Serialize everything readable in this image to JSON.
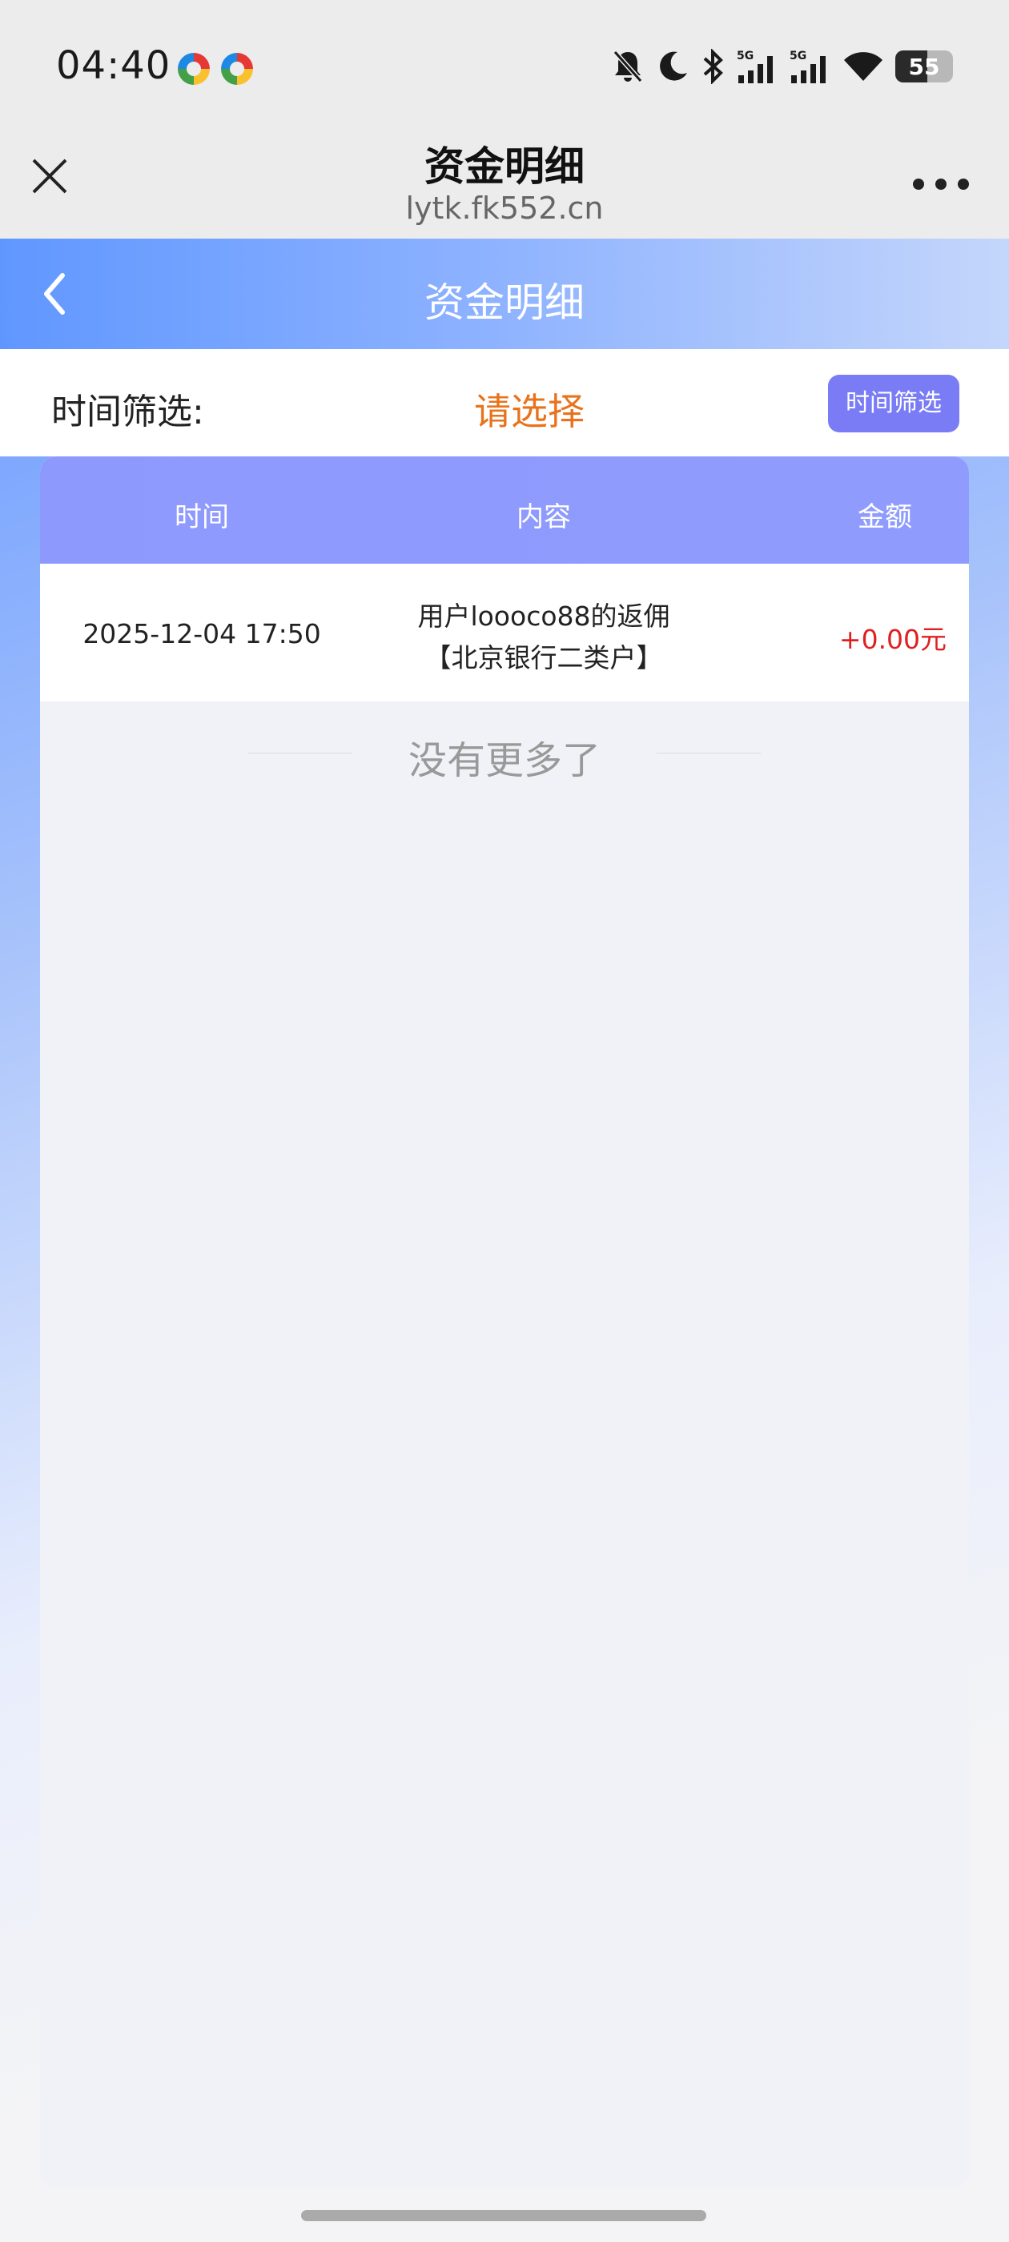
{
  "status_bar": {
    "time": "04:40",
    "battery": "55",
    "battery_level": 0.55,
    "icons": [
      "app-icon",
      "app-icon",
      "mute-bell-icon",
      "moon-icon",
      "bluetooth-icon",
      "signal-5g-icon",
      "signal-5g-icon",
      "wifi-icon",
      "battery-icon"
    ],
    "signal_label": "5G"
  },
  "browser": {
    "title": "资金明细",
    "url": "lytk.fk552.cn"
  },
  "page": {
    "title": "资金明细",
    "filter_label": "时间筛选:",
    "filter_placeholder": "请选择",
    "filter_button": "时间筛选"
  },
  "table": {
    "columns": [
      "时间",
      "内容",
      "金额"
    ],
    "rows": [
      {
        "time": "2025-12-04 17:50",
        "content_line1": "用户loooco88的返佣",
        "content_line2": "【北京银行二类户】",
        "amount": "+0.00元"
      }
    ],
    "no_more": "没有更多了"
  },
  "colors": {
    "accent": "#7a7cf6",
    "header_blue": "#6097ff",
    "amount_red": "#e02020",
    "select_orange": "#e8731c"
  }
}
